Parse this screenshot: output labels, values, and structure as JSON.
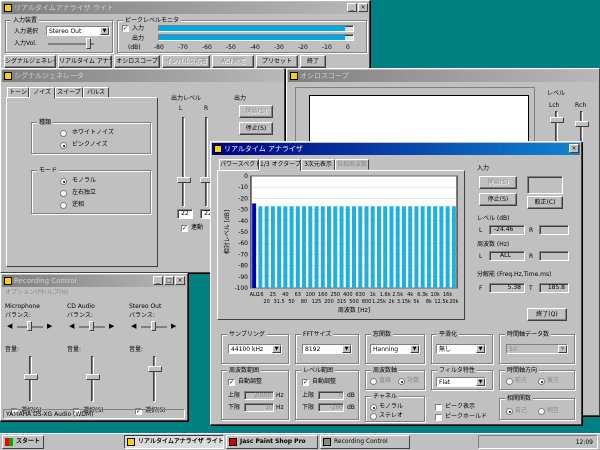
{
  "monitor": {
    "title": "リアルタイムアナライザ ライト",
    "input_group": "入力装置",
    "input_select_label": "入力選択",
    "input_select_value": "Stereo Out",
    "input_vol_label": "入力Vol.",
    "peak_group": "ピークレベルモニタ",
    "input_label": "入力",
    "output_label": "出力",
    "db_label": "(dB)",
    "scale": [
      "-80",
      "-70",
      "-60",
      "-50",
      "-40",
      "-30",
      "-20",
      "-10",
      "0"
    ],
    "input_level": 0.96,
    "output_level": 0.96,
    "buttons": [
      "シグナルジェネレータ",
      "リアルタイム アナライザ",
      "オシロスコープ",
      "インパルス応答",
      "ACF測定",
      "プリセット",
      "終了"
    ]
  },
  "siggen": {
    "title": "シグナルジェネレータ",
    "tabs": [
      "トーン",
      "ノイズ",
      "スイープ",
      "パルス"
    ],
    "kind_group": "種類",
    "white": "ホワイトノイズ",
    "pink": "ピンクノイズ",
    "mode_group": "モード",
    "mono": "モノラル",
    "lr": "左右独立",
    "reverse": "逆相",
    "out_level": "出力レベル",
    "L": "L",
    "R": "R",
    "output": "出力",
    "start": "開始(S)",
    "stop": "停止(S)",
    "lvl_l": "22",
    "lvl_r": "22",
    "link": "連動"
  },
  "osc": {
    "title": "オシロスコープ",
    "level": "レベル",
    "lch": "Lch",
    "rch": "Rch"
  },
  "rta": {
    "title": "リアルタイム アナライザ",
    "tabs": [
      "パワースペクトル",
      "1/3 オクターブ",
      "3次元表示",
      "位相周波数"
    ],
    "ylabel": "相対レベル [dB]",
    "xlabel": "周波数 [Hz]",
    "input_group": "入力",
    "start": "開始(S)",
    "stop": "停止(S)",
    "calib": "較正(C)",
    "level_group": "レベル (dB)",
    "L": "L",
    "R": "R",
    "level_l": "-24.46",
    "level_r": "",
    "freq_group": "周波数 (Hz)",
    "freq_l": "ALL",
    "freq_r": "",
    "res_group": "分解能 (Freq.Hz,Time.ms)",
    "F": "F",
    "T": "T",
    "res_f": "5.38",
    "res_t": "185.8",
    "close": "終了(Q)",
    "sampling_group": "サンプリング",
    "sampling": "44100 kHz",
    "fft_group": "FFTサイズ",
    "fft": "8192",
    "window_group": "窓関数",
    "window": "Hanning",
    "smooth_group": "平滑化",
    "smooth": "無し",
    "timeavg_group": "時間軸データ数",
    "timeavg": "50",
    "freqrange_group": "周波数範囲",
    "auto_adjust": "自動調整",
    "upper": "上限",
    "lower": "下限",
    "upper_val": "20000",
    "lower_val": "10",
    "hz": "Hz",
    "levelrange_group": "レベル範囲",
    "auto_adjust2": "自動調整",
    "upper2_val": "0",
    "lower2_val": "-160",
    "db": "dB",
    "freqaxis_group": "周波数軸",
    "linear": "直線",
    "log": "対数",
    "channel_group": "チャネル",
    "ch_mono": "モノラル",
    "ch_stereo": "ステレオ",
    "filter_group": "フィルタ特性",
    "filter": "Flat",
    "peak_show": "ピーク表示",
    "peak_hold": "ピークホールド",
    "timedir_group": "時間軸方向",
    "fwd": "前方",
    "back": "後方",
    "corr_group": "相関関数",
    "self": "自己",
    "cross": "相互"
  },
  "chart_data": {
    "type": "bar",
    "title": "",
    "xlabel": "周波数 [Hz]",
    "ylabel": "相対レベル [dB]",
    "x_tick_labels_row1": [
      "ALL",
      "16",
      "25",
      "40",
      "63",
      "100",
      "160",
      "250",
      "400",
      "630",
      "1k",
      "1.6k",
      "2.5k",
      "4k",
      "6.3k",
      "10k",
      "16k"
    ],
    "x_tick_labels_row2": [
      "20",
      "31.5",
      "50",
      "80",
      "125",
      "200",
      "315",
      "500",
      "800",
      "1.25k",
      "2k",
      "3.15k",
      "5k",
      "8k",
      "12.5k",
      "20k"
    ],
    "y_tick_labels": [
      "0",
      "-10",
      "-20",
      "-30",
      "-40",
      "-50",
      "-60",
      "-70",
      "-80",
      "-90",
      "-100"
    ],
    "ylim": [
      -100,
      0
    ],
    "categories": [
      "ALL",
      "16",
      "20",
      "25",
      "31.5",
      "40",
      "50",
      "63",
      "80",
      "100",
      "125",
      "160",
      "200",
      "250",
      "315",
      "400",
      "500",
      "630",
      "800",
      "1k",
      "1.25k",
      "1.6k",
      "2k",
      "2.5k",
      "3.15k",
      "4k",
      "5k",
      "6.3k",
      "8k",
      "10k",
      "12.5k",
      "16k",
      "20k"
    ],
    "values": [
      -24.5,
      -27,
      -27,
      -27,
      -27,
      -27,
      -27,
      -27,
      -27,
      -27,
      -27,
      -27,
      -27,
      -27,
      -27,
      -27,
      -27,
      -27,
      -27,
      -27,
      -27,
      -27,
      -27,
      -27,
      -27,
      -27,
      -27,
      -27,
      -27,
      -27,
      -27,
      -27,
      -27
    ],
    "colors": {
      "all": "#0000c0",
      "band": "#20b0e0"
    }
  },
  "mixer": {
    "title": "Recording Control",
    "menu": [
      "オプション(P)",
      "ヘルプ(H)"
    ],
    "channels": [
      {
        "name": "Microphone",
        "balance": "バランス:",
        "volume": "音量:",
        "select": "選択(S)",
        "checked": false
      },
      {
        "name": "CD Audio",
        "balance": "バランス:",
        "volume": "音量:",
        "select": "選択(S)",
        "checked": false
      },
      {
        "name": "Stereo Out",
        "balance": "バランス:",
        "volume": "音量:",
        "select": "選択(S)",
        "checked": true
      }
    ],
    "status": "YAMAHA DS-XG Audio (WDM)"
  },
  "taskbar": {
    "start": "スタート",
    "items": [
      "リアルタイムアナライザ ライト",
      "Jasc Paint Shop Pro",
      "Recording Control"
    ],
    "time": "12:09"
  }
}
